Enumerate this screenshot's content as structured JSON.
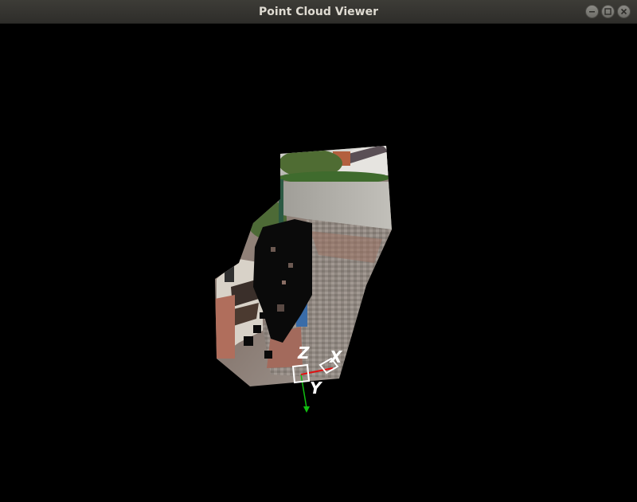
{
  "window": {
    "title": "Point Cloud Viewer",
    "controls": {
      "minimize_icon": "minimize-icon",
      "maximize_icon": "maximize-icon",
      "close_icon": "close-icon"
    }
  },
  "viewer": {
    "background_color": "#000000",
    "axes": {
      "x_label": "X",
      "y_label": "Y",
      "z_label": "Z",
      "x_color": "#e01010",
      "y_color": "#10c010",
      "z_color": "#1010e0"
    }
  }
}
